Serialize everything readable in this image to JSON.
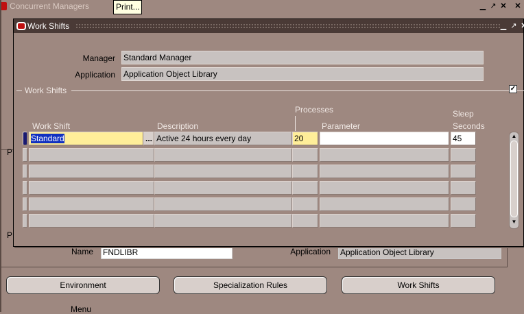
{
  "background_window": {
    "title": "Concurrent Managers",
    "print_tooltip": "Print...",
    "name_label": "Name",
    "name_value": "FNDLIBR",
    "application_label": "Application",
    "application_value": "Application Object Library",
    "panel_letter_1": "P",
    "panel_letter_2": "P",
    "buttons": {
      "environment": "Environment",
      "specialization": "Specialization Rules",
      "work_shifts": "Work Shifts"
    },
    "bottom_text": "Menu"
  },
  "dialog": {
    "title": "Work Shifts",
    "manager_label": "Manager",
    "manager_value": "Standard Manager",
    "application_label": "Application",
    "application_value": "Application Object Library",
    "section_title": "Work Shifts",
    "columns": {
      "work_shift": "Work Shift",
      "description": "Description",
      "processes": "Processes",
      "parameter": "Parameter",
      "sleep_seconds_1": "Sleep",
      "sleep_seconds_2": "Seconds"
    },
    "rows": [
      {
        "work_shift": "Standard",
        "lov": "...",
        "description": "Active 24 hours every day",
        "processes": "20",
        "parameter": "",
        "sleep": "45"
      },
      {
        "work_shift": "",
        "description": "",
        "processes": "",
        "parameter": "",
        "sleep": ""
      },
      {
        "work_shift": "",
        "description": "",
        "processes": "",
        "parameter": "",
        "sleep": ""
      },
      {
        "work_shift": "",
        "description": "",
        "processes": "",
        "parameter": "",
        "sleep": ""
      },
      {
        "work_shift": "",
        "description": "",
        "processes": "",
        "parameter": "",
        "sleep": ""
      },
      {
        "work_shift": "",
        "description": "",
        "processes": "",
        "parameter": "",
        "sleep": ""
      }
    ]
  },
  "colors": {
    "window_bg": "#9e8880",
    "titlebar": "#4a3a36",
    "active_field": "#ffee99",
    "selection": "#1030c0"
  }
}
